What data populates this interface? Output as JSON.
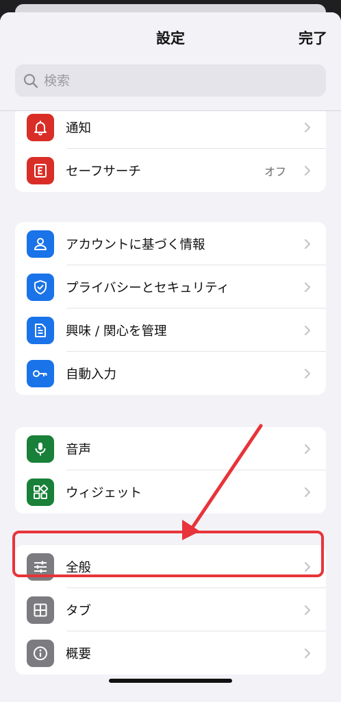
{
  "header": {
    "title": "設定",
    "done_label": "完了"
  },
  "search": {
    "placeholder": "検索",
    "icon": "search-icon"
  },
  "groups": [
    {
      "items": [
        {
          "label": "通知",
          "icon": "bell-icon",
          "color": "#d92e27"
        },
        {
          "label": "セーフサーチ",
          "icon": "safesearch-icon",
          "color": "#d92e27",
          "value": "オフ"
        }
      ]
    },
    {
      "items": [
        {
          "label": "アカウントに基づく情報",
          "icon": "person-icon",
          "color": "#1a73e8"
        },
        {
          "label": "プライバシーとセキュリティ",
          "icon": "shield-icon",
          "color": "#1a73e8"
        },
        {
          "label": "興味 / 関心を管理",
          "icon": "document-icon",
          "color": "#1a73e8"
        },
        {
          "label": "自動入力",
          "icon": "key-icon",
          "color": "#1a73e8"
        }
      ]
    },
    {
      "items": [
        {
          "label": "音声",
          "icon": "microphone-icon",
          "color": "#188038"
        },
        {
          "label": "ウィジェット",
          "icon": "widget-icon",
          "color": "#188038"
        }
      ]
    },
    {
      "items": [
        {
          "label": "全般",
          "icon": "sliders-icon",
          "color": "#7c7c80"
        },
        {
          "label": "タブ",
          "icon": "tabs-grid-icon",
          "color": "#7c7c80"
        },
        {
          "label": "概要",
          "icon": "info-icon",
          "color": "#7c7c80"
        }
      ]
    }
  ],
  "annotation": {
    "color": "#e8333a",
    "highlighted_item": "全般"
  }
}
